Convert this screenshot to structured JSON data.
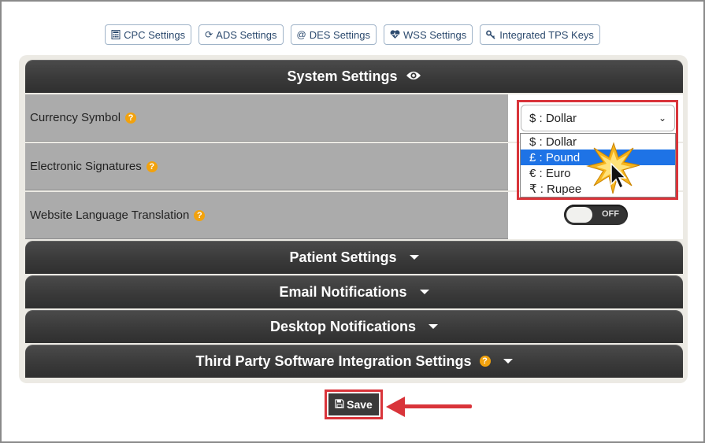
{
  "tabs": [
    {
      "label": "CPC Settings",
      "icon": "calculator-icon"
    },
    {
      "label": "ADS Settings",
      "icon": "refresh-icon"
    },
    {
      "label": "DES Settings",
      "icon": "at-icon"
    },
    {
      "label": "WSS Settings",
      "icon": "heartbeat-icon"
    },
    {
      "label": "Integrated TPS Keys",
      "icon": "key-icon"
    }
  ],
  "system": {
    "title": "System Settings",
    "icon": "eye-icon"
  },
  "rows": {
    "currency": "Currency Symbol",
    "esign": "Electronic Signatures",
    "translate": "Website Language Translation"
  },
  "currency_select": {
    "selected": "$ : Dollar",
    "options": [
      "$ : Dollar",
      "£ : Pound",
      "€ : Euro",
      "₹ : Rupee"
    ],
    "highlighted": "£ : Pound"
  },
  "toggle": {
    "label": "OFF",
    "state": "off"
  },
  "sections": {
    "patient": "Patient Settings",
    "email": "Email Notifications",
    "desktop": "Desktop Notifications",
    "third": "Third Party Software Integration Settings"
  },
  "save_label": "Save",
  "colors": {
    "accent_red": "#d9343a",
    "highlight_blue": "#1e73e6",
    "help_orange": "#f2a20d"
  }
}
